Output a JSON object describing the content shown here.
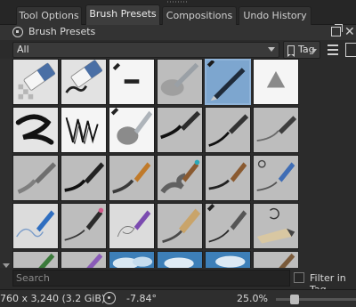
{
  "tabs": [
    {
      "label": "Tool Options",
      "active": false
    },
    {
      "label": "Brush Presets",
      "active": true
    },
    {
      "label": "Compositions",
      "active": false
    },
    {
      "label": "Undo History",
      "active": false
    }
  ],
  "docker": {
    "title": "Brush Presets"
  },
  "filter": {
    "selected": "All",
    "tag_label": "Tag"
  },
  "search": {
    "placeholder": "Search",
    "filter_in_tag_label": "Filter in Tag",
    "filter_in_tag_checked": false
  },
  "status": {
    "dimensions": "760 x 3,240 (3.2 GiB)",
    "rotation": "-7.84°",
    "zoom": "25.0%"
  },
  "presets": [
    {
      "name": "eraser-small-preset-icon"
    },
    {
      "name": "eraser-soft-preset-icon"
    },
    {
      "name": "basic-edit-line-preset-icon"
    },
    {
      "name": "airbrush-soft-preset-icon"
    },
    {
      "name": "pen-ink-selected-preset-icon",
      "selected": true
    },
    {
      "name": "triangle-shape-preset-icon"
    },
    {
      "name": "marker-bold-stroke-preset-icon"
    },
    {
      "name": "scribble-chalk-preset-icon"
    },
    {
      "name": "airbrush-edit-preset-icon"
    },
    {
      "name": "pen-thick-stroke-preset-icon"
    },
    {
      "name": "pen-texture-preset-icon"
    },
    {
      "name": "pen-light-stroke-preset-icon"
    },
    {
      "name": "pencil-gray-preset-icon"
    },
    {
      "name": "brush-dark-preset-icon"
    },
    {
      "name": "brush-orange-preset-icon"
    },
    {
      "name": "brush-teal-preset-icon"
    },
    {
      "name": "brush-ink-preset-icon"
    },
    {
      "name": "pencil-rotate-preset-icon"
    },
    {
      "name": "pencil-blue-preset-icon"
    },
    {
      "name": "pencil-pink-preset-icon"
    },
    {
      "name": "pencil-purple-preset-icon"
    },
    {
      "name": "pencil-wood-preset-icon"
    },
    {
      "name": "brush-edit-preset-icon"
    },
    {
      "name": "pencil-flip-preset-icon"
    },
    {
      "name": "pencil-green-preset-icon"
    },
    {
      "name": "brush-purple-preset-icon"
    },
    {
      "name": "texture-cloud-preset-icon"
    },
    {
      "name": "texture-cloud-blue-preset-icon"
    },
    {
      "name": "texture-cloud-sky-preset-icon"
    },
    {
      "name": "pencil-brown-preset-icon"
    }
  ],
  "colors": {
    "accent": "#8fb3d8",
    "panel": "#2b2b2b",
    "tile_light": "#e8e8e8",
    "tile_gray": "#bdbdbd"
  }
}
